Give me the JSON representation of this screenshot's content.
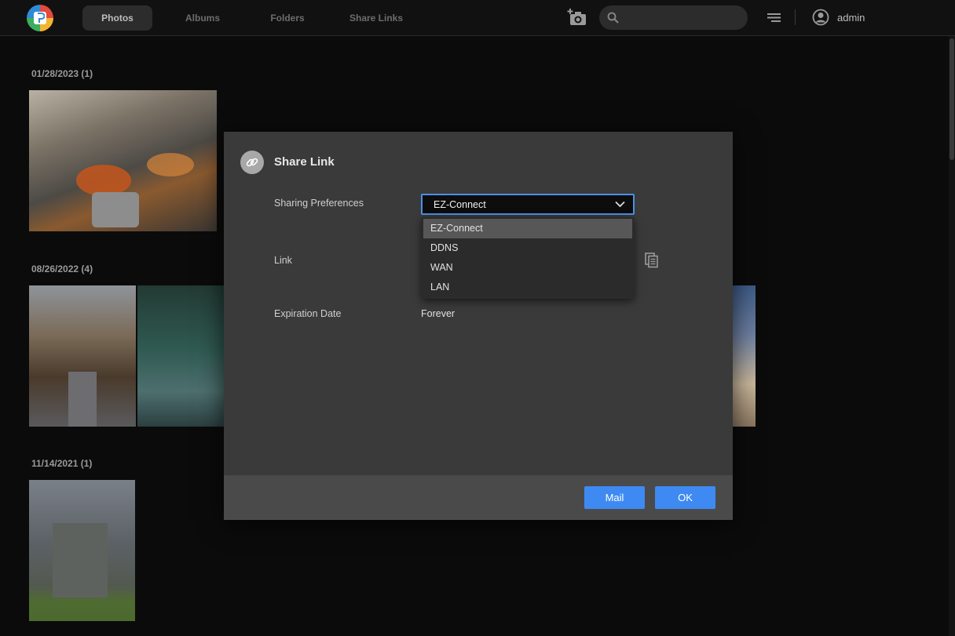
{
  "nav": {
    "tabs": [
      {
        "label": "Photos",
        "active": true
      },
      {
        "label": "Albums",
        "active": false
      },
      {
        "label": "Folders",
        "active": false
      },
      {
        "label": "Share Links",
        "active": false
      }
    ],
    "search_placeholder": "",
    "user": "admin"
  },
  "groups": [
    {
      "date": "01/28/2023 (1)",
      "photos": 1
    },
    {
      "date": "08/26/2022 (4)",
      "photos": 4
    },
    {
      "date": "11/14/2021 (1)",
      "photos": 1
    }
  ],
  "dialog": {
    "title": "Share Link",
    "sharing_label": "Sharing Preferences",
    "selected": "EZ-Connect",
    "options": [
      "EZ-Connect",
      "DDNS",
      "WAN",
      "LAN"
    ],
    "link_label": "Link",
    "expiration_label": "Expiration Date",
    "expiration_value": "Forever",
    "mail_button": "Mail",
    "ok_button": "OK"
  },
  "colors": {
    "accent": "#3e8af2",
    "focus_border": "#4d8fe6",
    "dialog_bg": "#3a3a3a",
    "footer_bg": "#4a4a4a"
  }
}
